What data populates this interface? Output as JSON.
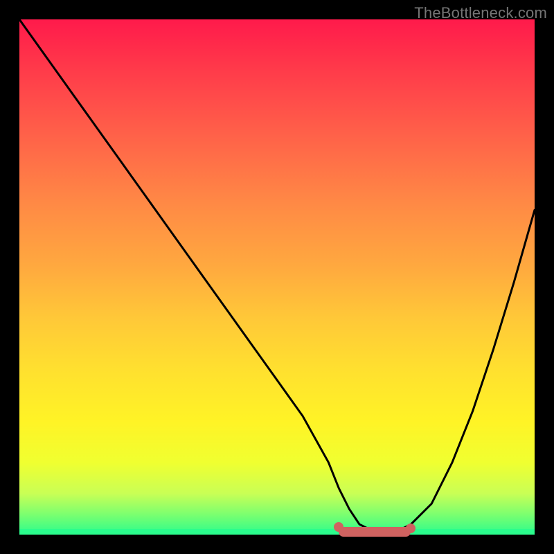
{
  "attribution": "TheBottleneck.com",
  "colors": {
    "frame": "#000000",
    "gradient_top": "#ff1a4b",
    "gradient_bottom": "#2bfc8d",
    "curve": "#000000",
    "highlight": "#cf6260"
  },
  "chart_data": {
    "type": "line",
    "title": "",
    "xlabel": "",
    "ylabel": "",
    "xlim": [
      0,
      100
    ],
    "ylim": [
      0,
      100
    ],
    "x": [
      0,
      5,
      10,
      15,
      20,
      25,
      30,
      35,
      40,
      45,
      50,
      55,
      60,
      62,
      64,
      66,
      68,
      70,
      72,
      74,
      76,
      80,
      84,
      88,
      92,
      96,
      100
    ],
    "values": [
      100,
      93,
      86,
      79,
      72,
      65,
      58,
      51,
      44,
      37,
      30,
      23,
      14,
      9,
      5,
      2,
      1,
      0.5,
      0.5,
      1,
      2,
      6,
      14,
      24,
      36,
      49,
      63
    ],
    "annotations": [
      {
        "kind": "valley_highlight",
        "x_start": 62,
        "x_end": 76,
        "y": 0.5
      }
    ]
  }
}
